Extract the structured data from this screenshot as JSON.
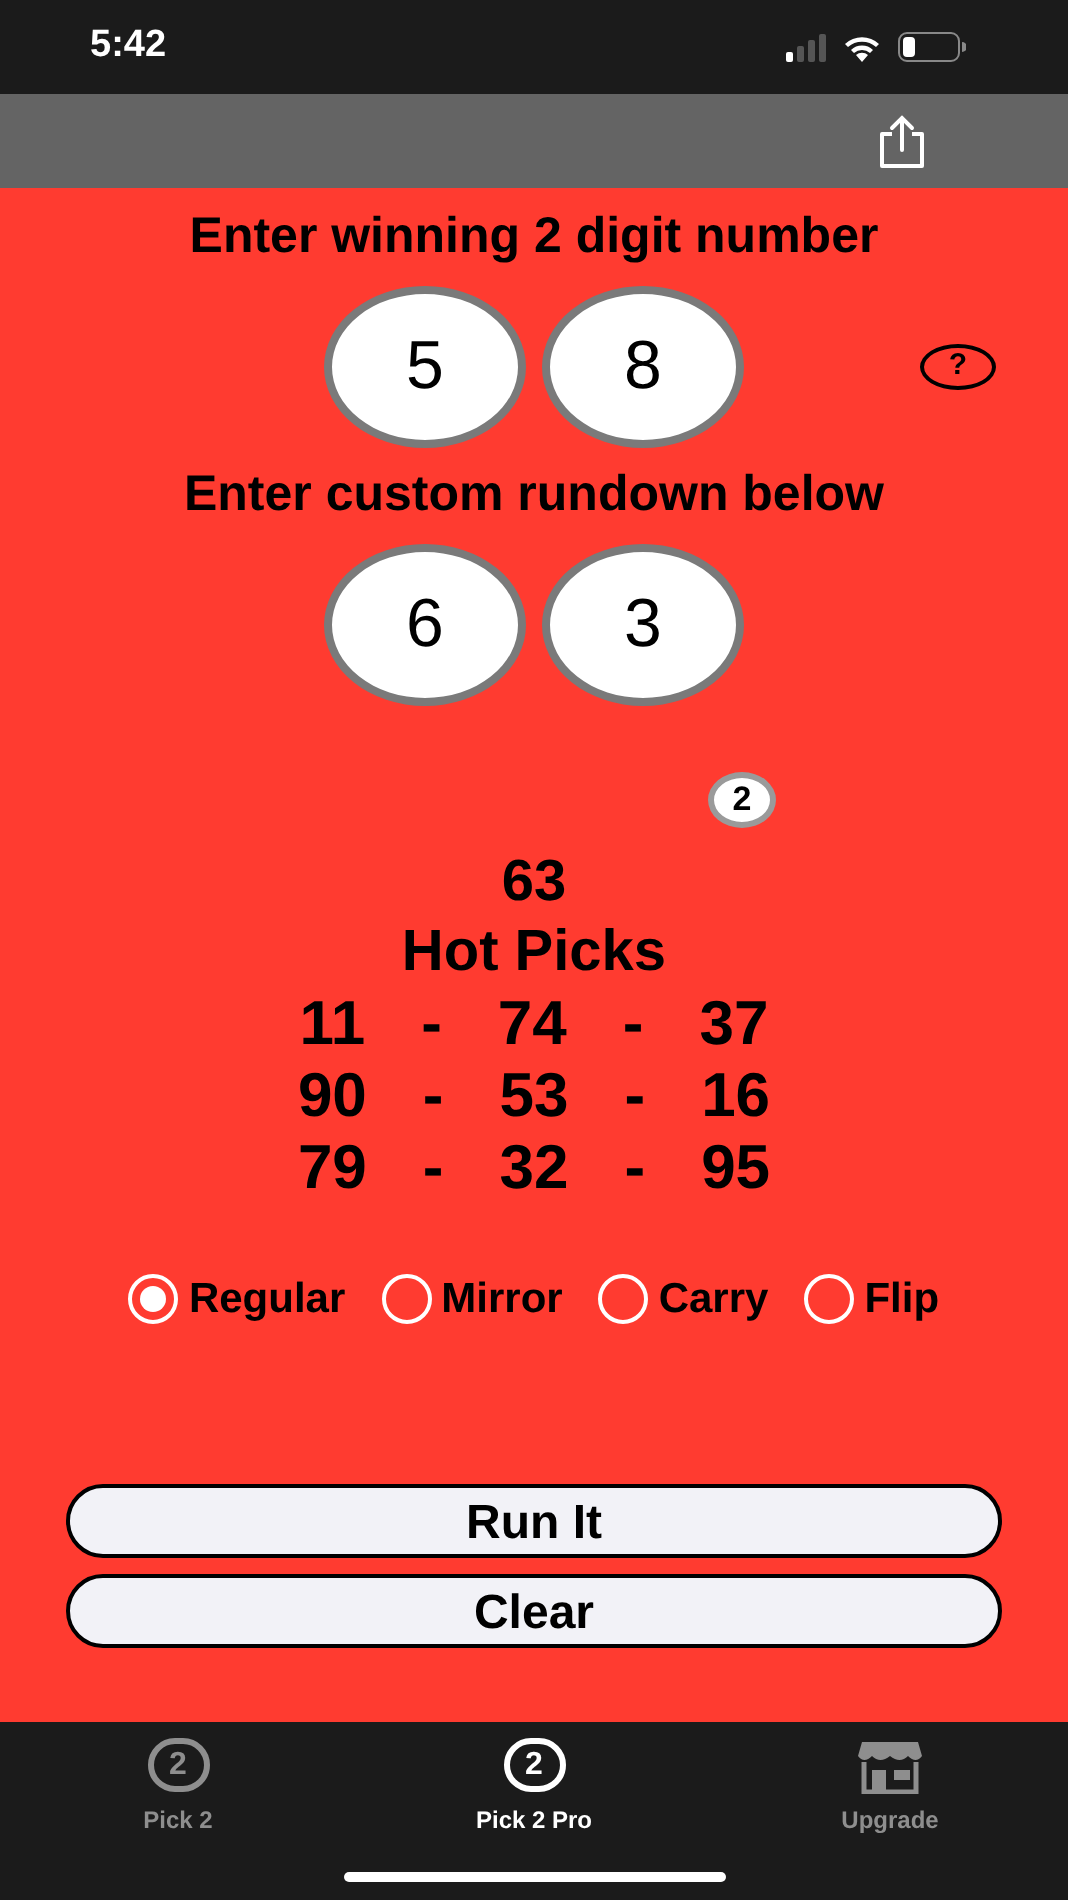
{
  "status_bar": {
    "time": "5:42"
  },
  "winning": {
    "label": "Enter winning 2 digit number",
    "digits": [
      "5",
      "8"
    ],
    "help": "?"
  },
  "rundown": {
    "label": "Enter custom rundown below",
    "digits": [
      "6",
      "3"
    ]
  },
  "ball_badge": "2",
  "result": "63",
  "hot_picks": {
    "title": "Hot Picks",
    "rows": [
      [
        "11",
        "-",
        "74",
        "-",
        "37"
      ],
      [
        "90",
        "-",
        "53",
        "-",
        "16"
      ],
      [
        "79",
        "-",
        "32",
        "-",
        "95"
      ]
    ]
  },
  "modes": [
    {
      "label": "Regular",
      "selected": true
    },
    {
      "label": "Mirror",
      "selected": false
    },
    {
      "label": "Carry",
      "selected": false
    },
    {
      "label": "Flip",
      "selected": false
    }
  ],
  "buttons": [
    "Run It",
    "Clear"
  ],
  "tabs": [
    {
      "label": "Pick 2",
      "icon_text": "2",
      "kind": "ball",
      "selected": false
    },
    {
      "label": "Pick 2 Pro",
      "icon_text": "2",
      "kind": "ball",
      "selected": true
    },
    {
      "label": "Upgrade",
      "kind": "store",
      "selected": false
    }
  ]
}
